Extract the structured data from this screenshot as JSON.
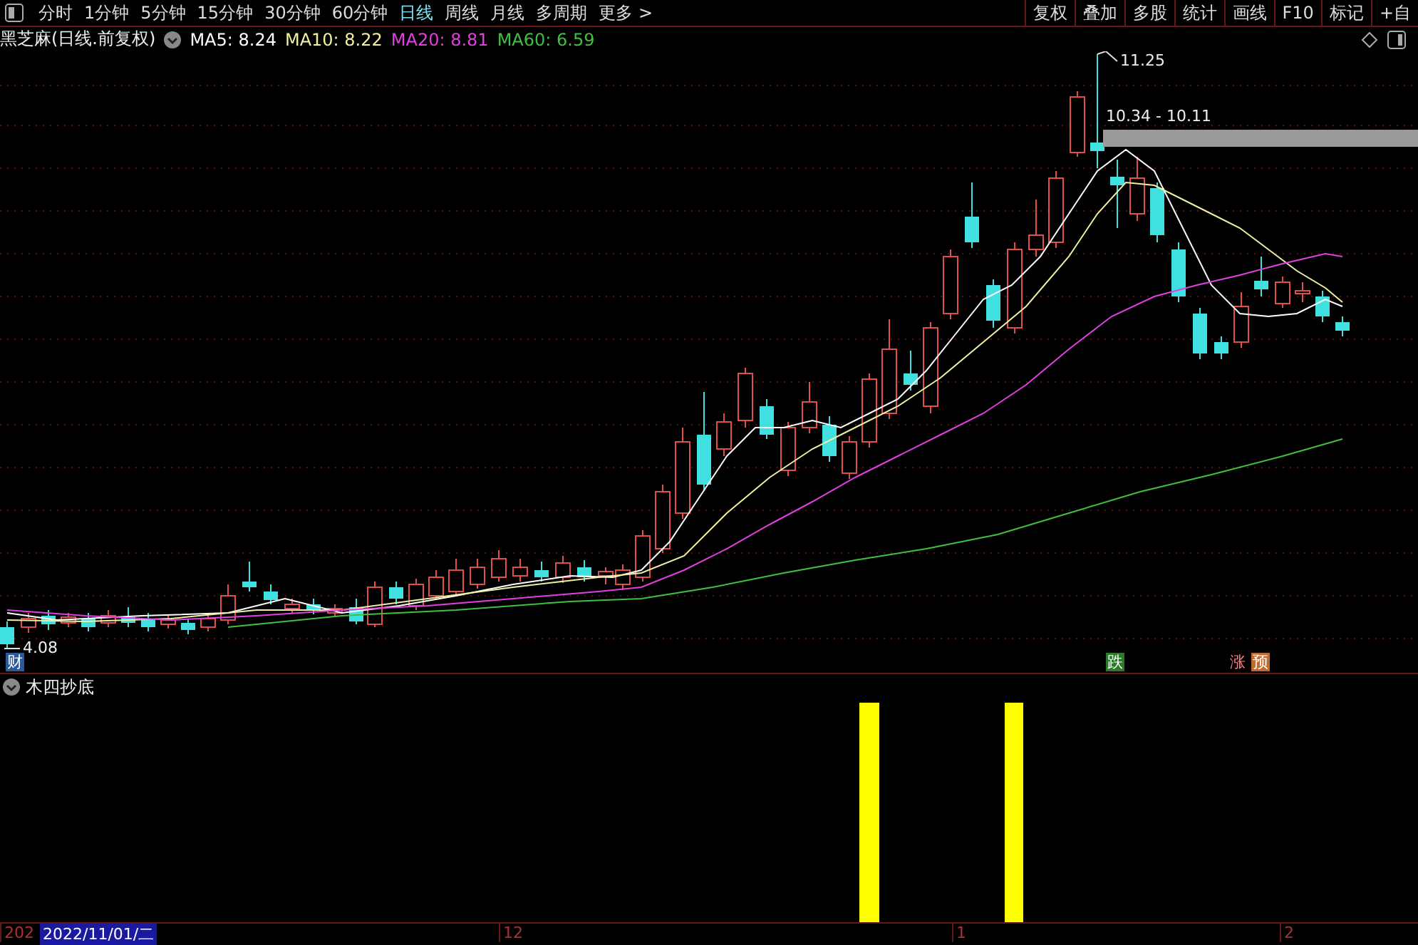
{
  "toolbar": {
    "periods": [
      {
        "label": "分时",
        "selected": false
      },
      {
        "label": "1分钟",
        "selected": false
      },
      {
        "label": "5分钟",
        "selected": false
      },
      {
        "label": "15分钟",
        "selected": false
      },
      {
        "label": "30分钟",
        "selected": false
      },
      {
        "label": "60分钟",
        "selected": false
      },
      {
        "label": "日线",
        "selected": true
      },
      {
        "label": "周线",
        "selected": false
      },
      {
        "label": "月线",
        "selected": false
      },
      {
        "label": "多周期",
        "selected": false
      },
      {
        "label": "更多 >",
        "selected": false
      }
    ],
    "tools": [
      "复权",
      "叠加",
      "多股",
      "统计",
      "画线",
      "F10",
      "标记",
      "+自"
    ]
  },
  "main_chart": {
    "title": "黑芝麻(日线.前复权)",
    "ma": [
      {
        "label": "MA5: 8.24",
        "color": "#ffffff"
      },
      {
        "label": "MA10: 8.22",
        "color": "#f0f0a0"
      },
      {
        "label": "MA20: 8.81",
        "color": "#e040e0"
      },
      {
        "label": "MA60: 6.59",
        "color": "#40c040"
      }
    ],
    "high_label": "11.25",
    "low_label": "4.08",
    "range_label": "10.34 - 10.11",
    "markers": [
      {
        "text": "财",
        "kind": "info"
      },
      {
        "text": "跌",
        "kind": "down"
      },
      {
        "text": "涨",
        "kind": "up"
      },
      {
        "text": "预",
        "kind": "forecast"
      }
    ]
  },
  "indicator": {
    "title": "木四抄底"
  },
  "time_axis": {
    "cursor_date": "2022/11/01/二",
    "labels": [
      "202",
      "12",
      "1",
      "2"
    ]
  }
}
